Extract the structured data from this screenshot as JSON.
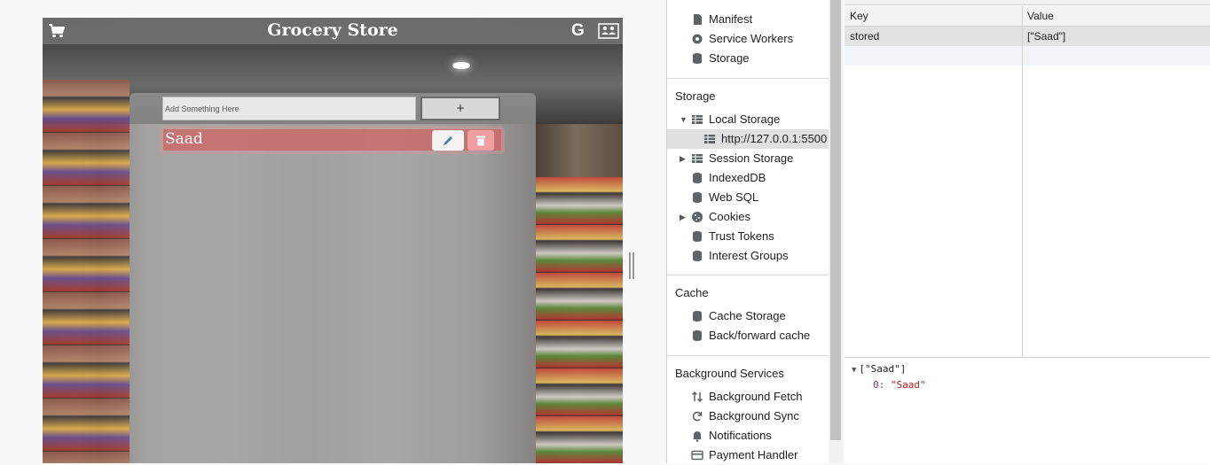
{
  "app": {
    "title": "Grocery Store",
    "google_glyph": "G",
    "input_placeholder": "Add Something Here",
    "add_label": "+",
    "items": [
      {
        "text": "Saad"
      }
    ]
  },
  "devtools": {
    "application_items": [
      {
        "label": "Manifest",
        "icon": "document-icon"
      },
      {
        "label": "Service Workers",
        "icon": "gear-icon"
      },
      {
        "label": "Storage",
        "icon": "database-icon"
      }
    ],
    "storage_section_title": "Storage",
    "storage_items": {
      "local_storage": "Local Storage",
      "local_storage_origin": "http://127.0.0.1:5500",
      "session_storage": "Session Storage",
      "indexeddb": "IndexedDB",
      "web_sql": "Web SQL",
      "cookies": "Cookies",
      "trust_tokens": "Trust Tokens",
      "interest_groups": "Interest Groups"
    },
    "cache_section_title": "Cache",
    "cache_items": {
      "cache_storage": "Cache Storage",
      "bfcache": "Back/forward cache"
    },
    "background_section_title": "Background Services",
    "background_items": {
      "fetch": "Background Fetch",
      "sync": "Background Sync",
      "notifications": "Notifications",
      "payment": "Payment Handler"
    }
  },
  "storage_table": {
    "columns": {
      "key": "Key",
      "value": "Value"
    },
    "rows": [
      {
        "key": "stored",
        "value": "[\"Saad\"]"
      }
    ],
    "preview_header": "[\"Saad\"]",
    "preview_index": "0:",
    "preview_value": "\"Saad\""
  }
}
